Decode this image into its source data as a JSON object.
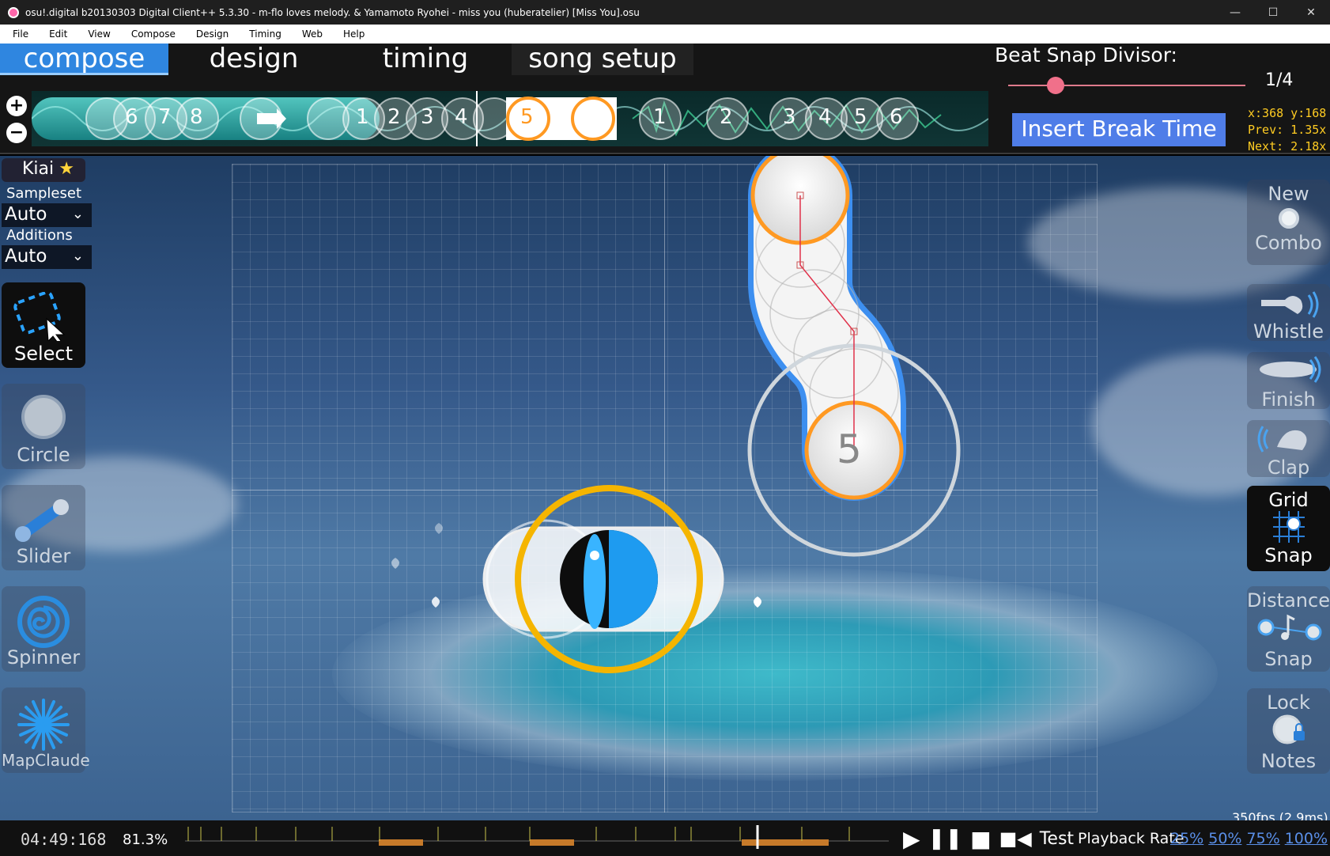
{
  "window": {
    "title": "osu!.digital b20130303 Digital Client++ 5.3.30 - m-flo loves melody. & Yamamoto Ryohei - miss you (huberatelier) [Miss You].osu",
    "controls": [
      "—",
      "☐",
      "✕"
    ]
  },
  "menu": {
    "items": [
      "File",
      "Edit",
      "View",
      "Compose",
      "Design",
      "Timing",
      "Web",
      "Help"
    ]
  },
  "modes": {
    "tabs": [
      "compose",
      "design",
      "timing",
      "song setup"
    ],
    "active": "compose"
  },
  "beat_snap": {
    "label": "Beat Snap Divisor:",
    "value": "1/4",
    "level": 0.2
  },
  "timeline": {
    "combo_numbers_left": [
      "6",
      "7",
      "8"
    ],
    "combo_numbers_mid": [
      "1",
      "2",
      "3",
      "4",
      "5"
    ],
    "combo_numbers_right": [
      "1",
      "2",
      "3",
      "4",
      "5",
      "6"
    ],
    "zoom_in": "+",
    "zoom_out": "−"
  },
  "break_button": "Insert Break Time",
  "status": {
    "coords": "x:368 y:168",
    "prev": "Prev: 1.35x",
    "next": "Next: 2.18x"
  },
  "left_panel": {
    "kiai": "Kiai",
    "sampleset_label": "Sampleset",
    "sampleset_value": "Auto",
    "additions_label": "Additions",
    "additions_value": "Auto",
    "tools": [
      "Select",
      "Circle",
      "Slider",
      "Spinner",
      "MapClaude"
    ]
  },
  "right_panel": {
    "new_combo": [
      "New",
      "Combo"
    ],
    "whistle": "Whistle",
    "finish": "Finish",
    "clap": "Clap",
    "grid_snap": [
      "Grid",
      "Snap"
    ],
    "distance_snap": [
      "Distance",
      "Snap"
    ],
    "lock_notes": [
      "Lock",
      "Notes"
    ]
  },
  "playfield": {
    "hit_circle_number": "5"
  },
  "bottom": {
    "time": "04:49:168",
    "percent": "81.3%",
    "fps": "350fps (2.9ms)",
    "test": "Test",
    "playback_label": "Playback Rate",
    "rates": [
      "25%",
      "50%",
      "75%",
      "100%"
    ]
  },
  "colors": {
    "accent": "#2f86e0",
    "break_button": "#4f7de8",
    "coords": "#ffcc22",
    "combo_orange": "#ff9922",
    "slider_border": "#3d8ff0"
  }
}
